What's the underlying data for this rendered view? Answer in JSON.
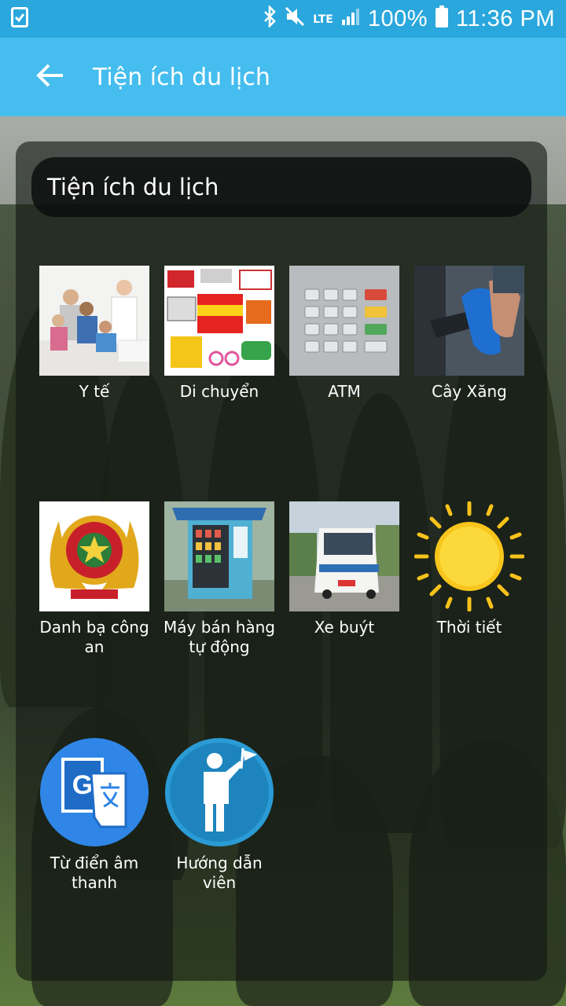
{
  "status_bar": {
    "network": "LTE",
    "battery": "100%",
    "time": "11:36 PM",
    "icons": [
      "checklist-icon",
      "bluetooth-icon",
      "mute-icon",
      "signal-icon",
      "battery-icon"
    ]
  },
  "app_bar": {
    "title": "Tiện ích du lịch",
    "back_icon": "arrow-left-icon"
  },
  "panel": {
    "header": "Tiện ích du lịch",
    "items": [
      {
        "label": "Y tế",
        "icon": "medical-family-image"
      },
      {
        "label": "Di chuyển",
        "icon": "vehicles-image"
      },
      {
        "label": "ATM",
        "icon": "atm-keypad-image"
      },
      {
        "label": "Cây Xăng",
        "icon": "fuel-nozzle-image"
      },
      {
        "label": "Danh bạ công an",
        "icon": "police-emblem-image"
      },
      {
        "label": "Máy bán hàng tự động",
        "icon": "vending-machine-image"
      },
      {
        "label": "Xe buýt",
        "icon": "bus-image"
      },
      {
        "label": "Thời tiết",
        "icon": "sun-icon"
      },
      {
        "label": "Từ điển âm thanh",
        "icon": "translate-icon"
      },
      {
        "label": "Hướng dẫn viên",
        "icon": "tour-guide-icon"
      }
    ]
  },
  "colors": {
    "status_bar": "#2aa7dc",
    "app_bar": "#45bdee",
    "circle_blue": "#2f86e6",
    "guide_blue": "#2b9bd6"
  }
}
